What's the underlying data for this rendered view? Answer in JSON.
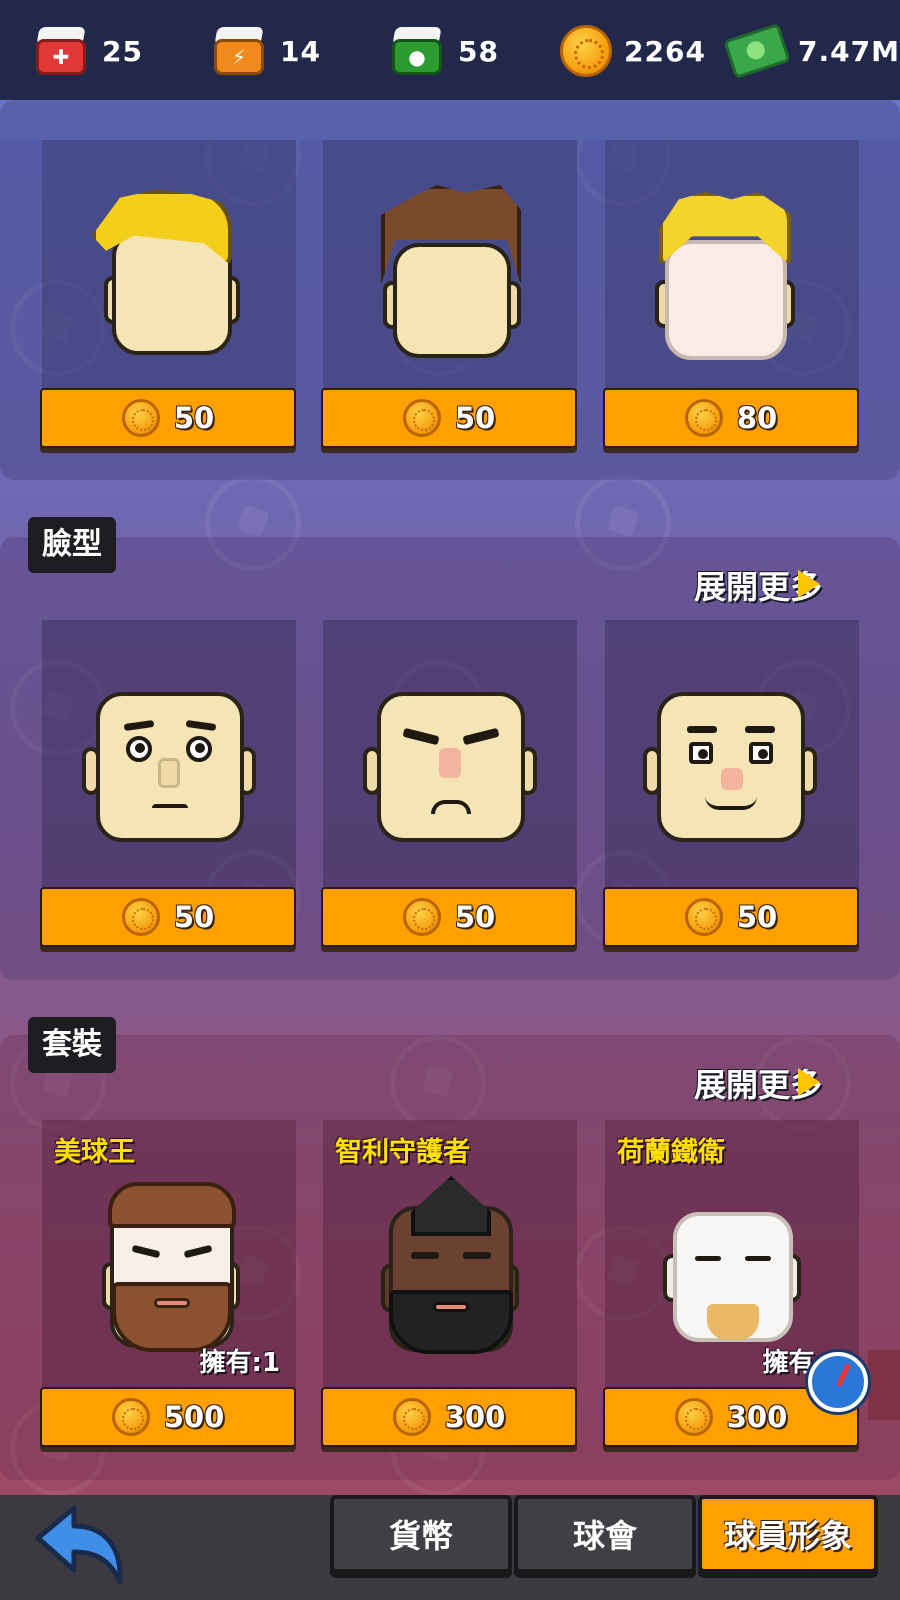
{
  "top_bar": {
    "resources": [
      {
        "icon": "red-medkit-cube-icon",
        "value": "25",
        "color": "#e03838"
      },
      {
        "icon": "orange-energy-cube-icon",
        "value": "14",
        "color": "#f08a1c"
      },
      {
        "icon": "green-cube-icon",
        "value": "58",
        "color": "#2e9a32"
      },
      {
        "icon": "gold-coin-icon",
        "value": "2264",
        "color": "#f7a313"
      },
      {
        "icon": "cash-icon",
        "value": "7.47M",
        "color": "#3aa84a"
      }
    ]
  },
  "hair_section": {
    "items": [
      {
        "hair_color": "#f3cf1a",
        "price": "50"
      },
      {
        "hair_color": "#7a4a2c",
        "price": "50"
      },
      {
        "hair_color": "#f4d42a",
        "price": "80"
      }
    ]
  },
  "face_section": {
    "title": "臉型",
    "more_label": "展開更多",
    "items": [
      {
        "price": "50"
      },
      {
        "price": "50"
      },
      {
        "price": "50"
      }
    ]
  },
  "outfit_section": {
    "title": "套裝",
    "more_label": "展開更多",
    "items": [
      {
        "name": "美球王",
        "owned": "擁有:1",
        "price": "500"
      },
      {
        "name": "智利守護者",
        "owned": "",
        "price": "300"
      },
      {
        "name": "荷蘭鐵衛",
        "owned": "擁有:1",
        "price": "300"
      }
    ]
  },
  "bottom_nav": {
    "tabs": [
      {
        "label": "貨幣",
        "active": false
      },
      {
        "label": "球會",
        "active": false
      },
      {
        "label": "球員形象",
        "active": true
      }
    ]
  },
  "colors": {
    "accent_button": "#ffa000",
    "section_title_yellow": "#ffe000",
    "top_bar_bg": "#22284a"
  }
}
